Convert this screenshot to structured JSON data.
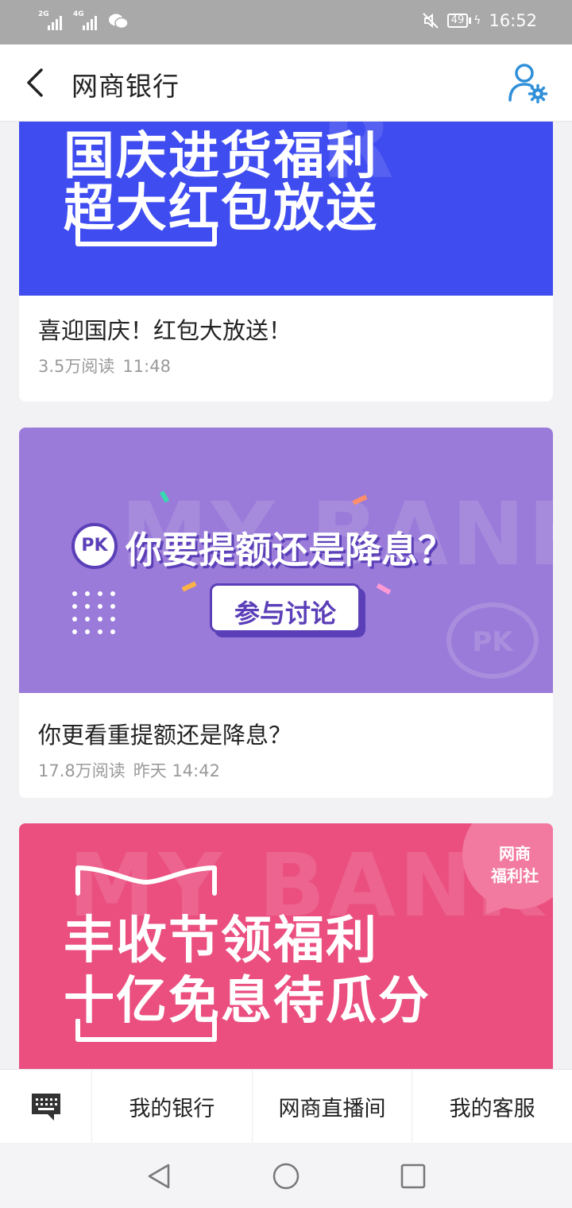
{
  "status_bar": {
    "net1": "2G",
    "net2": "4G",
    "battery": "49",
    "time": "16:52"
  },
  "header": {
    "title": "网商银行"
  },
  "articles": [
    {
      "banner_line1": "国庆进货福利",
      "banner_line2": "超大红包放送",
      "title": "喜迎国庆！红包大放送！",
      "reads": "3.5万阅读",
      "time": "11:48",
      "banner_color": "#3f4cf0"
    },
    {
      "banner_badge": "PK",
      "banner_line1": "你要提额还是降息？",
      "banner_button": "参与讨论",
      "banner_watermark": "MY BANK",
      "banner_corner": "PK",
      "title": "你更看重提额还是降息？",
      "reads": "17.8万阅读",
      "time": "昨天 14:42",
      "banner_color": "#9a7bd9"
    },
    {
      "banner_line1": "丰收节领福利",
      "banner_line2": "十亿免息待瓜分",
      "banner_watermark": "MY BANK",
      "banner_bubble": "网商\n福利社",
      "banner_bubble_line1": "网商",
      "banner_bubble_line2": "福利社",
      "banner_color": "#ea4f80"
    }
  ],
  "tabbar": {
    "keyboard_icon": "keyboard-icon",
    "tabs": [
      "我的银行",
      "网商直播间",
      "我的客服"
    ]
  },
  "colors": {
    "accent": "#2f8fd8",
    "status_bar": "#a9a9a9"
  }
}
